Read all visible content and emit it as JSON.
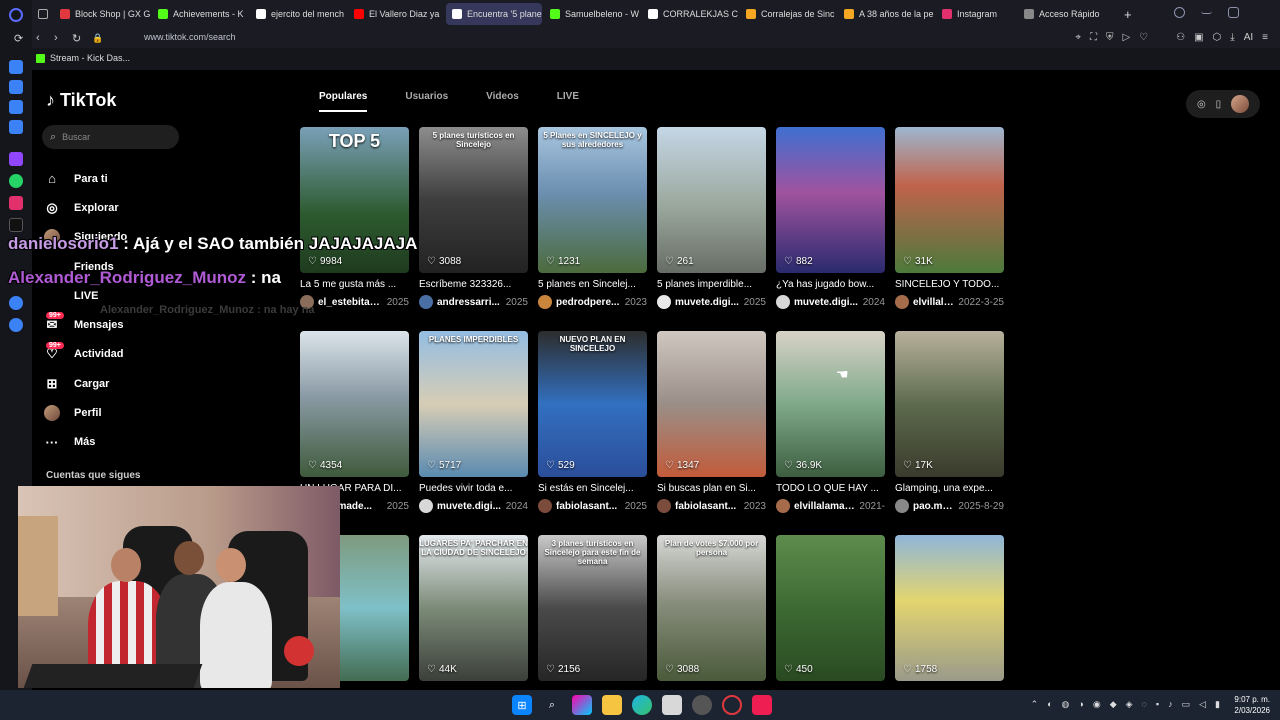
{
  "browser": {
    "tabs": [
      {
        "label": "Block Shop | GX G",
        "color": "#e0383e"
      },
      {
        "label": "Achievements - K",
        "color": "#53fc18"
      },
      {
        "label": "ejercito del mench",
        "color": "#ffffff"
      },
      {
        "label": "El Vallero Diaz ya",
        "color": "#ff0000"
      },
      {
        "label": "Encuentra '5 planes para",
        "color": "#ffffff",
        "active": true
      },
      {
        "label": "Samuelbeleno - W",
        "color": "#53fc18"
      },
      {
        "label": "CORRALEKJAS CI",
        "color": "#ffffff"
      },
      {
        "label": "Corralejas de Sinc",
        "color": "#f5a623"
      },
      {
        "label": "A 38 años de la pe",
        "color": "#f5a623"
      },
      {
        "label": "Instagram",
        "color": "#e1306c"
      },
      {
        "label": "Acceso Rápido",
        "color": "#888888"
      }
    ],
    "new_tab": "+",
    "url": "www.tiktok.com/search",
    "bookmark": "Stream - Kick Das..."
  },
  "tiktok": {
    "logo": "TikTok",
    "search_placeholder": "Buscar",
    "nav": [
      {
        "label": "Para ti",
        "icon": "⌂",
        "name": "home-icon"
      },
      {
        "label": "Explorar",
        "icon": "◎",
        "name": "compass-icon"
      },
      {
        "label": "Siguiendo",
        "icon": "",
        "name": "following-icon",
        "avatar": true
      },
      {
        "label": "Friends",
        "icon": "",
        "name": "friends-icon"
      },
      {
        "label": "LIVE",
        "icon": "",
        "name": "live-icon"
      },
      {
        "label": "Mensajes",
        "icon": "✉",
        "name": "messages-icon",
        "badge": "99+"
      },
      {
        "label": "Actividad",
        "icon": "♡",
        "name": "activity-icon",
        "badge": "99+"
      },
      {
        "label": "Cargar",
        "icon": "⊞",
        "name": "upload-icon"
      },
      {
        "label": "Perfil",
        "icon": "",
        "name": "profile-icon",
        "avatar": true
      },
      {
        "label": "Más",
        "icon": "···",
        "name": "more-icon"
      }
    ],
    "follow_title": "Cuentas que sigues",
    "tabs": [
      "Populares",
      "Usuarios",
      "Videos",
      "LIVE"
    ],
    "videos": [
      {
        "views": "9984",
        "desc": "La 5 me gusta más ...",
        "user": "el_estebitan...",
        "date": "2025",
        "bg": "linear-gradient(180deg,#7aa0b8,#2c5a2e 60%,#1f3b1f)",
        "overlay": "TOP 5"
      },
      {
        "views": "3088",
        "desc": "Escríbeme 323326...",
        "user": "andressarri...",
        "date": "2025",
        "bg": "linear-gradient(180deg,#8d8d8d,#3e3e3e 50%,#222)",
        "overlay": "5 planes turísticos en Sincelejo"
      },
      {
        "views": "1231",
        "desc": "5 planes en Sincelej...",
        "user": "pedrodpere...",
        "date": "2023",
        "bg": "linear-gradient(180deg,#a9c6e0,#6b8fb0 45%,#4c6b3d)",
        "overlay": "5 Planes en SINCELEJO y sus alrededores"
      },
      {
        "views": "261",
        "desc": "5 planes imperdible...",
        "user": "muvete.digi...",
        "date": "2025",
        "bg": "linear-gradient(180deg,#c5d6e6,#9aa79c 55%,#676d66)",
        "overlay": ""
      },
      {
        "views": "882",
        "desc": "¿Ya has jugado bow...",
        "user": "muvete.digi...",
        "date": "2024",
        "bg": "linear-gradient(180deg,#3f6fd0,#a0539f 45%,#2a2a6e)",
        "overlay": ""
      },
      {
        "views": "31K",
        "desc": "SINCELEJO Y TODO...",
        "user": "elvillalamar...",
        "date": "2022-3-25",
        "bg": "linear-gradient(180deg,#9db7cf,#c0634c 40%,#4c7a3c)",
        "overlay": ""
      },
      {
        "views": "4354",
        "desc": "UN LUGAR PARA DI...",
        "user": "villamade...",
        "date": "2025",
        "bg": "linear-gradient(180deg,#dbe4ea,#8a9aa5 45%,#3f5a3b)",
        "overlay": ""
      },
      {
        "views": "5717",
        "desc": "Puedes vivir toda e...",
        "user": "muvete.digi...",
        "date": "2024",
        "bg": "linear-gradient(180deg,#93bde3,#d7cdb5 50%,#5a8ab0)",
        "overlay": "PLANES IMPERDIBLES"
      },
      {
        "views": "529",
        "desc": "Si estás en Sincelej...",
        "user": "fabiolasant...",
        "date": "2025",
        "bg": "linear-gradient(180deg,#2d2d2d,#3270c0 50%,#2b4e9a)",
        "overlay": "NUEVO PLAN EN SINCELEJO"
      },
      {
        "views": "1347",
        "desc": "Si buscas plan en Si...",
        "user": "fabiolasant...",
        "date": "2023",
        "bg": "linear-gradient(180deg,#cfc7c0,#9a8f88 50%,#c25b3a)",
        "overlay": ""
      },
      {
        "views": "36.9K",
        "desc": "TODO LO QUE HAY ...",
        "user": "elvillalamar...",
        "date": "2021-",
        "bg": "linear-gradient(180deg,#d7d2c6,#7fa98a 50%,#3d5e40)",
        "overlay": ""
      },
      {
        "views": "17K",
        "desc": "Glamping, una expe...",
        "user": "pao.marzola",
        "date": "2025-8-29",
        "bg": "linear-gradient(180deg,#b7b19c,#5d6b4d 50%,#3a3a2c)",
        "overlay": ""
      },
      {
        "views": "37",
        "desc": "",
        "user": "",
        "date": "",
        "bg": "linear-gradient(180deg,#7e9a7e,#7fc0c8 50%,#436c52)",
        "overlay": ""
      },
      {
        "views": "44K",
        "desc": "",
        "user": "",
        "date": "",
        "bg": "linear-gradient(180deg,#e4e9ee,#7c8b78 50%,#3c3f3a)",
        "overlay": "LUGARES PA' PARCHAR EN LA CIUDAD DE SINCELEJO"
      },
      {
        "views": "2156",
        "desc": "",
        "user": "",
        "date": "",
        "bg": "linear-gradient(180deg,#c9c9c9,#4a4a4a 50%,#262626)",
        "overlay": "3 planes turísticos en Sincelejo para este fin de semana"
      },
      {
        "views": "3088",
        "desc": "",
        "user": "",
        "date": "",
        "bg": "linear-gradient(180deg,#d7d8d6,#8a8f7e 45%,#4a5a3a)",
        "overlay": "Plan de votes $7.000 por persona"
      },
      {
        "views": "450",
        "desc": "",
        "user": "",
        "date": "",
        "bg": "linear-gradient(180deg,#5e8c4e,#3c6a32 50%,#2a4a22)",
        "overlay": ""
      },
      {
        "views": "1758",
        "desc": "",
        "user": "",
        "date": "",
        "bg": "linear-gradient(180deg,#8fb6d9,#e3d56f 45%,#9a9a8a)",
        "overlay": ""
      }
    ]
  },
  "chat": [
    {
      "user": "danielosorio1",
      "sep": " : ",
      "msg": "Ajá y el SAO también JAJAJAJAJA"
    },
    {
      "user": "Alexander_Rodriguez_Munoz",
      "sep": " : ",
      "msg": "na"
    }
  ],
  "chat_ghost": "Alexander_Rodriguez_Munoz : na hay na",
  "taskbar": {
    "time": "9:07 p. m.",
    "date": "2/03/2026"
  }
}
